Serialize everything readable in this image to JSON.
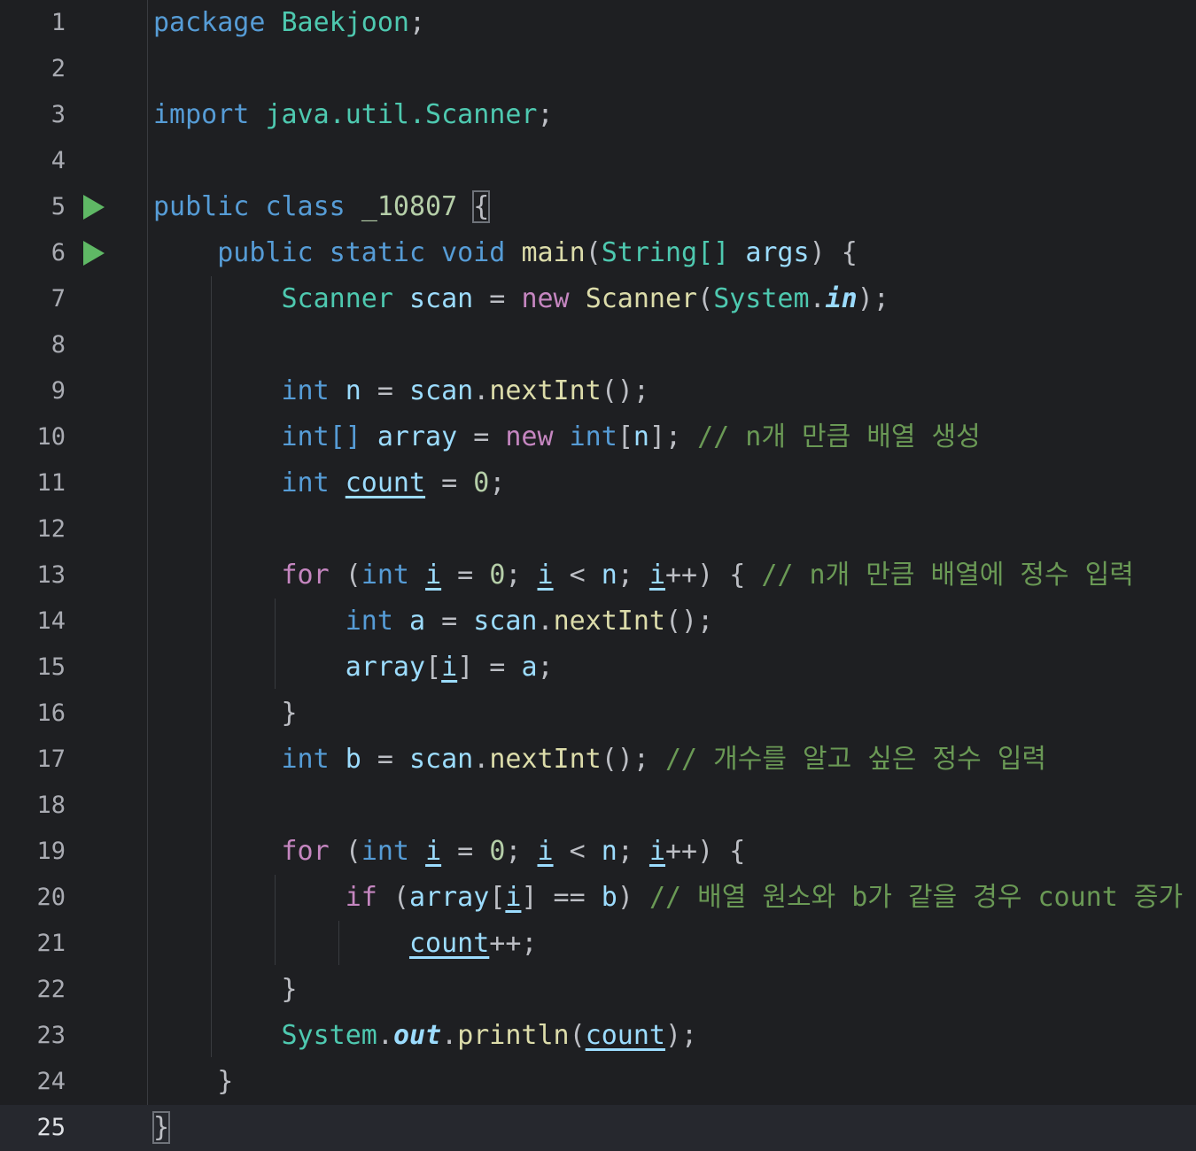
{
  "editor": {
    "line_numbers": [
      "1",
      "2",
      "3",
      "4",
      "5",
      "6",
      "7",
      "8",
      "9",
      "10",
      "11",
      "12",
      "13",
      "14",
      "15",
      "16",
      "17",
      "18",
      "19",
      "20",
      "21",
      "22",
      "23",
      "24",
      "25"
    ],
    "tokens": {
      "package_kw": "package",
      "package_name": "Baekjoon",
      "semicolon": ";",
      "import_kw": "import",
      "import_path": "java.util.Scanner",
      "public_kw": "public",
      "class_kw": "class",
      "class_name": "_10807",
      "open_brace": "{",
      "close_brace": "}",
      "static_kw": "static",
      "void_kw": "void",
      "main_fn": "main",
      "string_type": "String[]",
      "args_param": "args",
      "scanner_type": "Scanner",
      "scan_var": "scan",
      "new_kw": "new",
      "system_cls": "System",
      "in_field": "in",
      "out_field": "out",
      "int_kw": "int",
      "int_arr": "int[]",
      "n_var": "n",
      "next_int": "nextInt",
      "array_var": "array",
      "count_var": "count",
      "zero": "0",
      "for_kw": "for",
      "if_kw": "if",
      "i_var": "i",
      "a_var": "a",
      "b_var": "b",
      "println_fn": "println",
      "comment_10": "// n개 만큼 배열 생성",
      "comment_13": "// n개 만큼 배열에 정수 입력",
      "comment_17": "// 개수를 알고 싶은 정수 입력",
      "comment_20": "// 배열 원소와 b가 같을 경우 count 증가"
    }
  }
}
